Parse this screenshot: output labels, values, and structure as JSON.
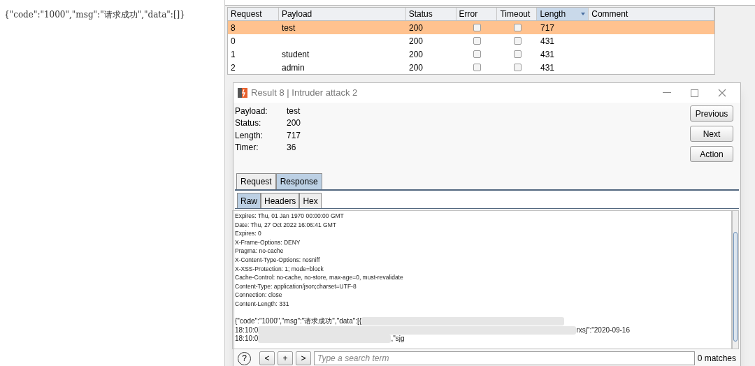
{
  "browser_text": "{\"code\":\"1000\",\"msg\":\"请求成功\",\"data\":[]}",
  "results_table": {
    "columns": [
      {
        "label": "Request",
        "sorted": false
      },
      {
        "label": "Payload",
        "sorted": false
      },
      {
        "label": "Status",
        "sorted": false
      },
      {
        "label": "Error",
        "sorted": false
      },
      {
        "label": "Timeout",
        "sorted": false
      },
      {
        "label": "Length",
        "sorted": true
      },
      {
        "label": "Comment",
        "sorted": false
      }
    ],
    "rows": [
      {
        "request": "8",
        "payload": "test",
        "status": "200",
        "error": false,
        "timeout": false,
        "length": "717",
        "selected": true
      },
      {
        "request": "0",
        "status": "200",
        "error": false,
        "timeout": false,
        "length": "431",
        "selected": false
      },
      {
        "request": "1",
        "payload": "student",
        "status": "200",
        "error": false,
        "timeout": false,
        "length": "431",
        "selected": false
      },
      {
        "request": "2",
        "payload": "admin",
        "status": "200",
        "error": false,
        "timeout": false,
        "length": "431",
        "selected": false
      }
    ]
  },
  "dialog": {
    "title": "Result 8 | Intruder attack 2",
    "fields": [
      {
        "label": "Payload:",
        "value": "test"
      },
      {
        "label": "Status:",
        "value": "200"
      },
      {
        "label": "Length:",
        "value": "717"
      },
      {
        "label": "Timer:",
        "value": "36"
      }
    ],
    "buttons": [
      "Previous",
      "Next",
      "Action"
    ],
    "tabs": [
      {
        "label": "Request",
        "selected": false
      },
      {
        "label": "Response",
        "selected": true
      }
    ],
    "subtabs": [
      {
        "label": "Raw",
        "selected": true
      },
      {
        "label": "Headers",
        "selected": false
      },
      {
        "label": "Hex",
        "selected": false
      }
    ],
    "response_lines": [
      "Expires: Thu, 01 Jan 1970 00:00:00 GMT",
      "Date: Thu, 27 Oct 2022 16:06:41 GMT",
      "Expires: 0",
      "X-Frame-Options: DENY",
      "Pragma: no-cache",
      "X-Content-Type-Options: nosniff",
      "X-XSS-Protection: 1; mode=block",
      "Cache-Control: no-cache, no-store, max-age=0, must-revalidate",
      "Content-Type: application/json;charset=UTF-8",
      "Connection: close",
      "Content-Length: 331"
    ],
    "body_lines": [
      {
        "before": "{\"code\":\"1000\",\"msg\":\"请求成功\",\"data\":[{"
      },
      {
        "before": "18:10:0",
        "after": "rxsj\":\"2020-09-16"
      },
      {
        "before": "18:10:0",
        "after": ",\"sjg"
      }
    ],
    "search": {
      "help": "?",
      "prev": "<",
      "add": "+",
      "next": ">",
      "placeholder": "Type a search term",
      "matches": "0 matches"
    }
  }
}
